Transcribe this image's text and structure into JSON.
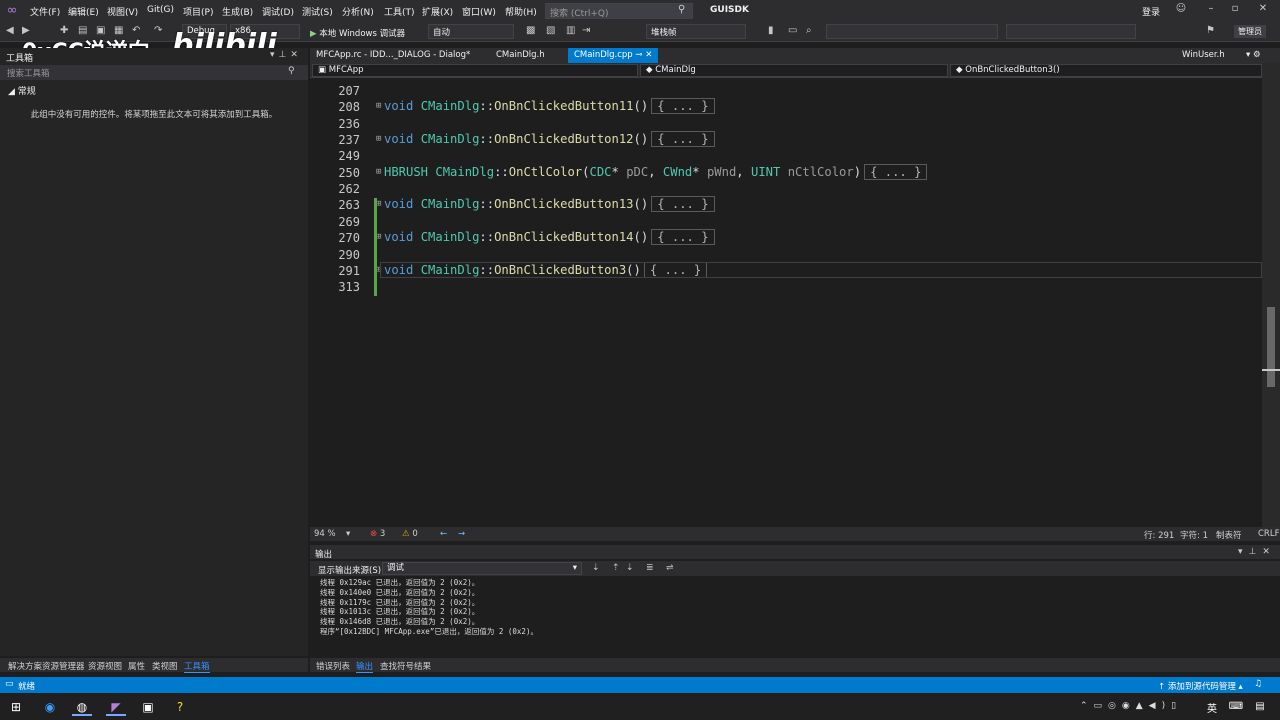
{
  "menubar": {
    "items": [
      "文件(F)",
      "编辑(E)",
      "视图(V)",
      "Git(G)",
      "项目(P)",
      "生成(B)",
      "调试(D)",
      "测试(S)",
      "分析(N)",
      "工具(T)",
      "扩展(X)",
      "窗口(W)",
      "帮助(H)"
    ],
    "search_placeholder": "搜索 (Ctrl+Q)",
    "solution_name": "GUISDK",
    "login": "登录"
  },
  "toolbar": {
    "config": "Debug",
    "platform": "x86",
    "run_label": "本地 Windows 调试器",
    "auto": "自动",
    "stack_frame": "堆栈帧",
    "manage": "管理员"
  },
  "watermark": {
    "channel": "0xCC说逆向",
    "site": "bilibili"
  },
  "toolbox": {
    "title": "工具箱",
    "search_placeholder": "搜索工具箱",
    "group": "常规",
    "empty_text": "此组中没有可用的控件。将某项拖至此文本可将其添加到工具箱。"
  },
  "left_tabs": [
    "解决方案资源管理器",
    "资源视图",
    "属性",
    "类视图",
    "工具箱"
  ],
  "doc_tabs": {
    "tab1": "MFCApp.rc - IDD..._DIALOG - Dialog*",
    "tab2": "CMainDlg.h",
    "tab3": "CMainDlg.cpp",
    "right": "WinUser.h"
  },
  "navbar": {
    "project": "MFCApp",
    "class": "CMainDlg",
    "member": "OnBnClickedButton3()"
  },
  "editor": {
    "lines": [
      {
        "n": "207",
        "code": ""
      },
      {
        "n": "208",
        "ret": "void",
        "cls": "CMainDlg",
        "fn": "OnBnClickedButton11",
        "params": "()"
      },
      {
        "n": "236",
        "code": ""
      },
      {
        "n": "237",
        "ret": "void",
        "cls": "CMainDlg",
        "fn": "OnBnClickedButton12",
        "params": "()"
      },
      {
        "n": "249",
        "code": ""
      },
      {
        "n": "250",
        "ret": "HBRUSH",
        "cls": "CMainDlg",
        "fn": "OnCtlColor",
        "params": "(CDC* pDC, CWnd* pWnd, UINT nCtlColor)"
      },
      {
        "n": "262",
        "code": ""
      },
      {
        "n": "263",
        "ret": "void",
        "cls": "CMainDlg",
        "fn": "OnBnClickedButton13",
        "params": "()"
      },
      {
        "n": "269",
        "code": ""
      },
      {
        "n": "270",
        "ret": "void",
        "cls": "CMainDlg",
        "fn": "OnBnClickedButton14",
        "params": "()"
      },
      {
        "n": "290",
        "code": ""
      },
      {
        "n": "291",
        "ret": "void",
        "cls": "CMainDlg",
        "fn": "OnBnClickedButton3",
        "params": "()"
      },
      {
        "n": "313",
        "code": ""
      }
    ],
    "collapsed": "{ ... }"
  },
  "edstatus": {
    "zoom": "94 %",
    "errors": "3",
    "warnings": "0",
    "line": "行: 291",
    "char": "字符: 1",
    "tabs": "制表符",
    "eol": "CRLF"
  },
  "output": {
    "title": "输出",
    "source_label": "显示输出来源(S):",
    "source_value": "调试",
    "lines": [
      "线程 0x129ac 已退出，返回值为 2 (0x2)。",
      "线程 0x140e0 已退出，返回值为 2 (0x2)。",
      "线程 0x1179c 已退出，返回值为 2 (0x2)。",
      "线程 0x1013c 已退出，返回值为 2 (0x2)。",
      "线程 0x146d8 已退出，返回值为 2 (0x2)。",
      "程序“[0x12BDC] MFCApp.exe”已退出，返回值为 2 (0x2)。"
    ]
  },
  "bottom_tabs": [
    "错误列表",
    "输出",
    "查找符号结果"
  ],
  "statusbar": {
    "ready": "就绪",
    "scm": "添加到源代码管理"
  },
  "taskbar": {
    "ime": "英"
  },
  "colors": {
    "accent": "#007acc",
    "keyword": "#569cd6",
    "type": "#4ec9b0",
    "function": "#dcdcaa"
  }
}
